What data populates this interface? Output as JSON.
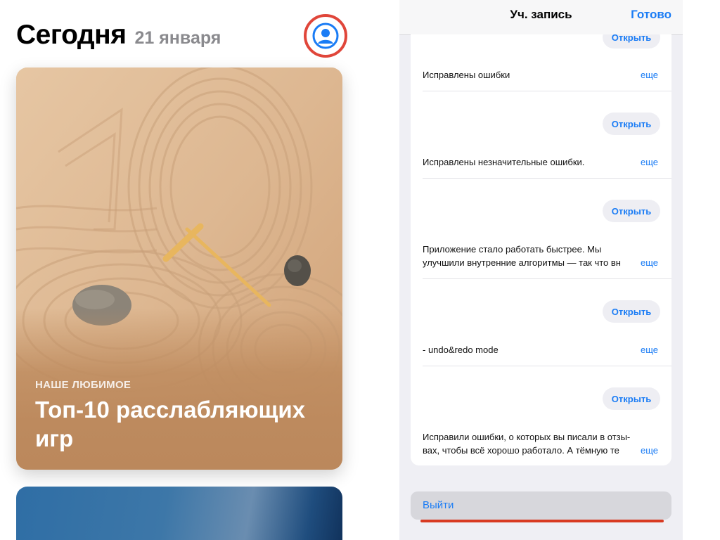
{
  "today": {
    "title": "Сегодня",
    "date": "21 января",
    "featured": {
      "eyebrow": "НАШЕ ЛЮБИМОЕ",
      "title": "Топ-10 расслабляющих игр"
    }
  },
  "account_sheet": {
    "title": "Уч. запись",
    "done_label": "Готово",
    "open_label": "Открыть",
    "more_label": "еще",
    "updates": [
      {
        "notes": [
          "Исправлены ошибки"
        ]
      },
      {
        "notes": [
          "Исправлены незначительные ошибки."
        ]
      },
      {
        "notes": [
          "Приложение стало работать быстрее. Мы",
          "улучшили внутренние алгоритмы — так что вн"
        ]
      },
      {
        "notes": [
          "- undo&redo mode"
        ]
      },
      {
        "notes": [
          "Исправили ошибки, о которых вы писали в отзы-",
          "вах, чтобы всё хорошо работало. А тёмную те"
        ]
      }
    ],
    "logout_label": "Выйти"
  },
  "colors": {
    "accent_blue": "#1a7cf5",
    "highlight_red": "#e0463a"
  },
  "icons": {
    "account": "person-circle-icon"
  }
}
